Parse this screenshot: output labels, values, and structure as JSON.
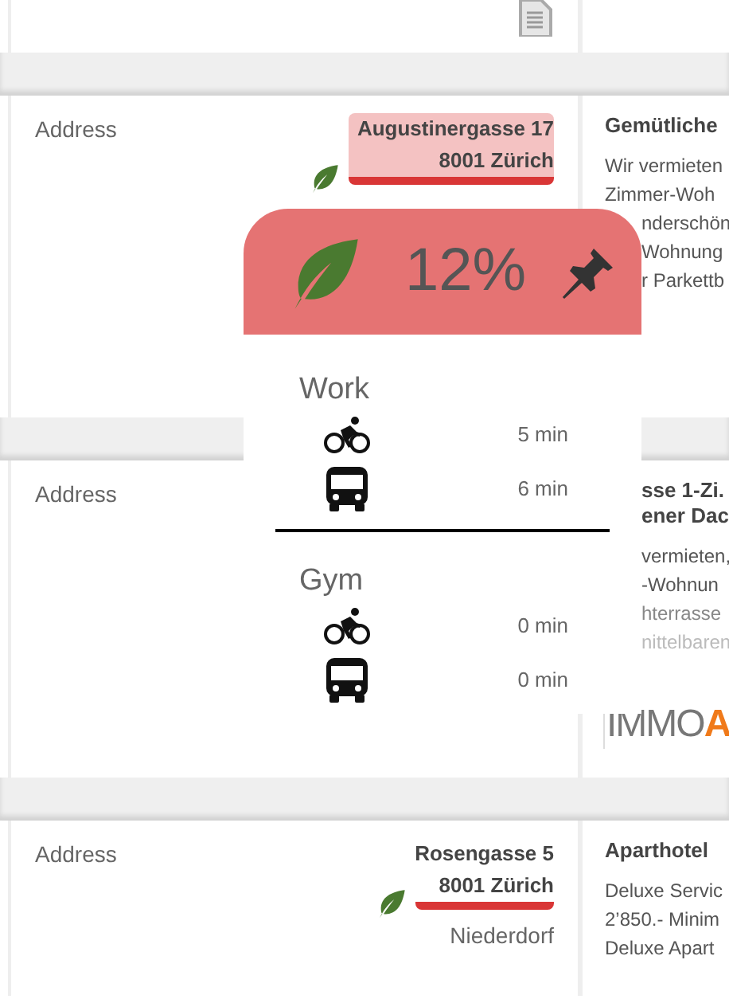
{
  "listings": [
    {
      "label": "Address",
      "street": "Augustinergasse 17",
      "city": "8001 Zürich",
      "eco": true,
      "highlighted": true,
      "title": [
        "Gemütliche"
      ],
      "description": [
        "Wir vermieten",
        "Zimmer-Woh",
        "nderschön",
        "Wohnung",
        "r Parkettb"
      ]
    },
    {
      "label": "Address",
      "title": [
        "sse 1-Zi.",
        "ener Dac"
      ],
      "description": [
        "vermieten,",
        "-Wohnun",
        "hterrasse",
        "nittelbaren"
      ],
      "logo": {
        "text": "IMMO",
        "accent": "A"
      }
    },
    {
      "label": "Address",
      "street": "Rosengasse 5",
      "city": "8001 Zürich",
      "eco": true,
      "highlighted": false,
      "district": "Niederdorf",
      "title": [
        "Aparthotel"
      ],
      "description": [
        "Deluxe Servic",
        "2’850.- Minim",
        "Deluxe Apart"
      ]
    }
  ],
  "popup": {
    "score": "12%",
    "places": [
      {
        "name": "Work",
        "trips": [
          {
            "kind": "bike",
            "time": "5 min"
          },
          {
            "kind": "bus",
            "time": "6 min"
          }
        ]
      },
      {
        "name": "Gym",
        "trips": [
          {
            "kind": "bike",
            "time": "0 min"
          },
          {
            "kind": "bus",
            "time": "0 min"
          }
        ]
      }
    ]
  }
}
